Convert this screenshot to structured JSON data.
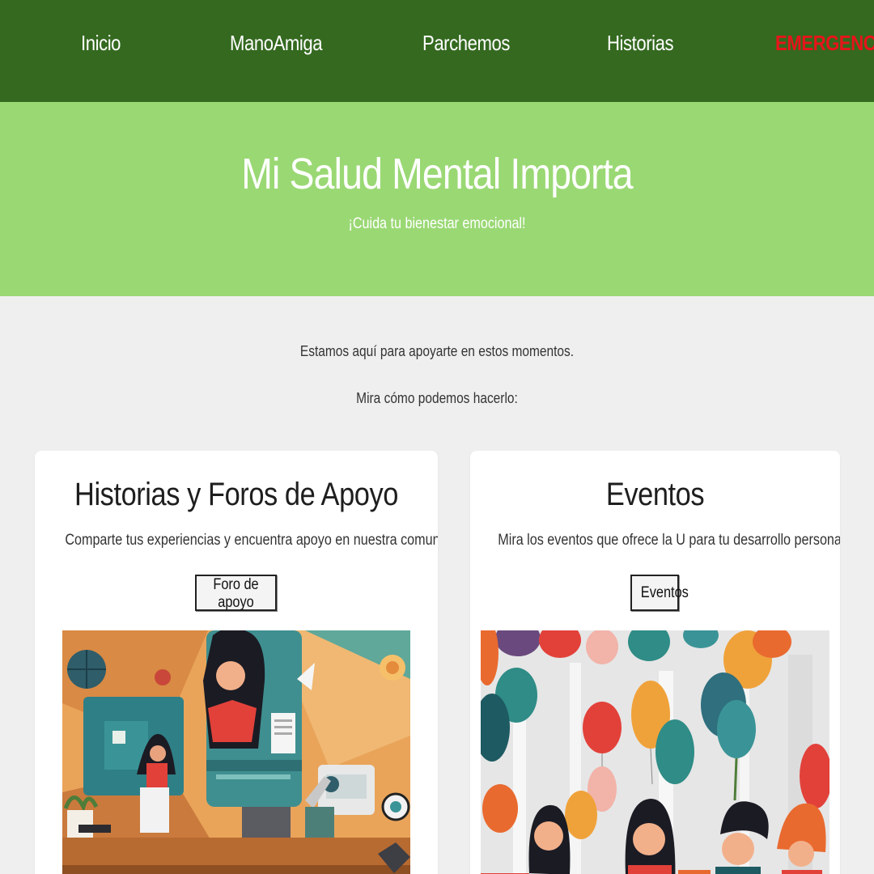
{
  "nav": {
    "items": [
      "Inicio",
      "ManoAmiga",
      "Parchemos",
      "Historias"
    ],
    "emergency": "EMERGENCIA"
  },
  "hero": {
    "title": "Mi Salud Mental Importa",
    "subtitle": "¡Cuida tu bienestar emocional!"
  },
  "intro": {
    "line1": "Estamos aquí para apoyarte en estos momentos.",
    "line2": "Mira cómo podemos hacerlo:"
  },
  "cards": [
    {
      "title": "Historias y Foros de Apoyo",
      "description": "Comparte tus experiencias y encuentra apoyo en nuestra comunidad en línea.",
      "button": "Foro de apoyo"
    },
    {
      "title": "Eventos",
      "description": "Mira los eventos que ofrece la U para tu desarrollo personal.",
      "button": "Eventos"
    }
  ],
  "colors": {
    "nav_bg": "#34691f",
    "hero_bg": "#9ad874",
    "emergency": "#e8141a",
    "page_bg": "#efefef"
  }
}
